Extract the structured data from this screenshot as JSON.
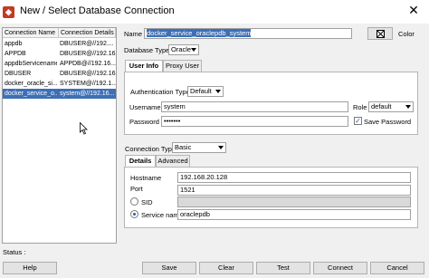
{
  "window": {
    "title": "New / Select Database Connection",
    "close_glyph": "✕",
    "app_icon": "sql-developer-icon",
    "app_icon_glyph": "◆"
  },
  "connections": {
    "headers": [
      "Connection Name",
      "Connection Details"
    ],
    "rows": [
      {
        "name": "appdb",
        "details": "DBUSER@//192...."
      },
      {
        "name": "APPDB",
        "details": "DBUSER@//192.16..."
      },
      {
        "name": "appdbServicename",
        "details": "APPDB@//192.16..."
      },
      {
        "name": "DBUSER",
        "details": "DBUSER@//192.16..."
      },
      {
        "name": "docker_oracle_si...",
        "details": "SYSTEM@//192.1..."
      },
      {
        "name": "docker_service_o...",
        "details": "system@//192.16...",
        "selected": true
      }
    ]
  },
  "form": {
    "name_label": "Name",
    "name_value": "docker_service_oraclepdb_system",
    "color_label": "Color",
    "database_type_label": "Database Type",
    "database_type_value": "Oracle",
    "tabs": [
      "User Info",
      "Proxy User"
    ],
    "auth_type_label": "Authentication Type",
    "auth_type_value": "Default",
    "username_label": "Username",
    "username_value": "system",
    "role_label": "Role",
    "role_value": "default",
    "password_label": "Password",
    "password_value": "•••••••",
    "save_password_label": "Save Password",
    "save_password_checked": true,
    "connection_type_label": "Connection Type",
    "connection_type_value": "Basic",
    "conn_tabs": [
      "Details",
      "Advanced"
    ],
    "hostname_label": "Hostname",
    "hostname_value": "192.168.20.128",
    "port_label": "Port",
    "port_value": "1521",
    "sid_label": "SID",
    "sid_selected": false,
    "service_name_label": "Service name",
    "service_name_value": "oraclepdb",
    "service_name_selected": true
  },
  "status": {
    "label": "Status :"
  },
  "buttons": {
    "help": "Help",
    "save": "Save",
    "clear": "Clear",
    "test": "Test",
    "connect": "Connect",
    "cancel": "Cancel"
  },
  "colors": {
    "selection": "#3d6fb6",
    "window_bg": "#f0f0f0"
  }
}
